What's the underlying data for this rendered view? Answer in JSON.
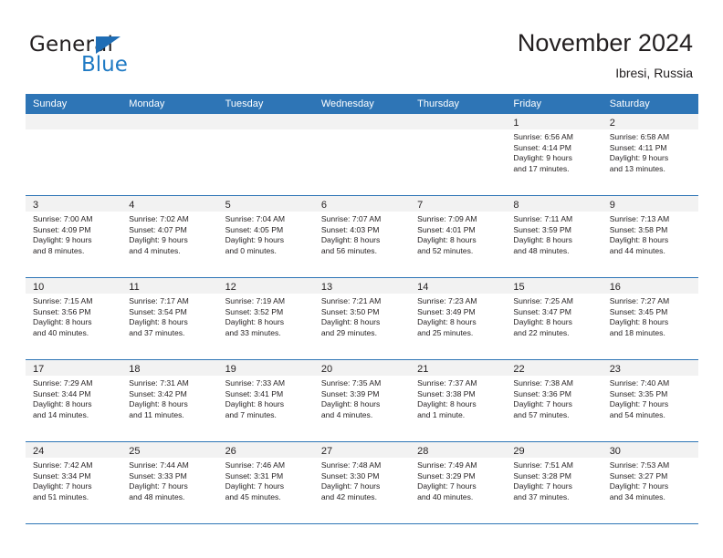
{
  "brand": {
    "name_part1": "General",
    "name_part2": "Blue",
    "triangle_icon": "triangle-icon",
    "accent_color": "#1f7ac4"
  },
  "header": {
    "title": "November 2024",
    "subtitle": "Ibresi, Russia"
  },
  "calendar": {
    "header_bg": "#2e75b6",
    "daynum_strip_bg": "#f2f2f2",
    "weekdays": [
      "Sunday",
      "Monday",
      "Tuesday",
      "Wednesday",
      "Thursday",
      "Friday",
      "Saturday"
    ],
    "weeks": [
      [
        {
          "day": "",
          "empty": true
        },
        {
          "day": "",
          "empty": true
        },
        {
          "day": "",
          "empty": true
        },
        {
          "day": "",
          "empty": true
        },
        {
          "day": "",
          "empty": true
        },
        {
          "day": "1",
          "sunrise": "Sunrise: 6:56 AM",
          "sunset": "Sunset: 4:14 PM",
          "daylight1": "Daylight: 9 hours",
          "daylight2": "and 17 minutes."
        },
        {
          "day": "2",
          "sunrise": "Sunrise: 6:58 AM",
          "sunset": "Sunset: 4:11 PM",
          "daylight1": "Daylight: 9 hours",
          "daylight2": "and 13 minutes."
        }
      ],
      [
        {
          "day": "3",
          "sunrise": "Sunrise: 7:00 AM",
          "sunset": "Sunset: 4:09 PM",
          "daylight1": "Daylight: 9 hours",
          "daylight2": "and 8 minutes."
        },
        {
          "day": "4",
          "sunrise": "Sunrise: 7:02 AM",
          "sunset": "Sunset: 4:07 PM",
          "daylight1": "Daylight: 9 hours",
          "daylight2": "and 4 minutes."
        },
        {
          "day": "5",
          "sunrise": "Sunrise: 7:04 AM",
          "sunset": "Sunset: 4:05 PM",
          "daylight1": "Daylight: 9 hours",
          "daylight2": "and 0 minutes."
        },
        {
          "day": "6",
          "sunrise": "Sunrise: 7:07 AM",
          "sunset": "Sunset: 4:03 PM",
          "daylight1": "Daylight: 8 hours",
          "daylight2": "and 56 minutes."
        },
        {
          "day": "7",
          "sunrise": "Sunrise: 7:09 AM",
          "sunset": "Sunset: 4:01 PM",
          "daylight1": "Daylight: 8 hours",
          "daylight2": "and 52 minutes."
        },
        {
          "day": "8",
          "sunrise": "Sunrise: 7:11 AM",
          "sunset": "Sunset: 3:59 PM",
          "daylight1": "Daylight: 8 hours",
          "daylight2": "and 48 minutes."
        },
        {
          "day": "9",
          "sunrise": "Sunrise: 7:13 AM",
          "sunset": "Sunset: 3:58 PM",
          "daylight1": "Daylight: 8 hours",
          "daylight2": "and 44 minutes."
        }
      ],
      [
        {
          "day": "10",
          "sunrise": "Sunrise: 7:15 AM",
          "sunset": "Sunset: 3:56 PM",
          "daylight1": "Daylight: 8 hours",
          "daylight2": "and 40 minutes."
        },
        {
          "day": "11",
          "sunrise": "Sunrise: 7:17 AM",
          "sunset": "Sunset: 3:54 PM",
          "daylight1": "Daylight: 8 hours",
          "daylight2": "and 37 minutes."
        },
        {
          "day": "12",
          "sunrise": "Sunrise: 7:19 AM",
          "sunset": "Sunset: 3:52 PM",
          "daylight1": "Daylight: 8 hours",
          "daylight2": "and 33 minutes."
        },
        {
          "day": "13",
          "sunrise": "Sunrise: 7:21 AM",
          "sunset": "Sunset: 3:50 PM",
          "daylight1": "Daylight: 8 hours",
          "daylight2": "and 29 minutes."
        },
        {
          "day": "14",
          "sunrise": "Sunrise: 7:23 AM",
          "sunset": "Sunset: 3:49 PM",
          "daylight1": "Daylight: 8 hours",
          "daylight2": "and 25 minutes."
        },
        {
          "day": "15",
          "sunrise": "Sunrise: 7:25 AM",
          "sunset": "Sunset: 3:47 PM",
          "daylight1": "Daylight: 8 hours",
          "daylight2": "and 22 minutes."
        },
        {
          "day": "16",
          "sunrise": "Sunrise: 7:27 AM",
          "sunset": "Sunset: 3:45 PM",
          "daylight1": "Daylight: 8 hours",
          "daylight2": "and 18 minutes."
        }
      ],
      [
        {
          "day": "17",
          "sunrise": "Sunrise: 7:29 AM",
          "sunset": "Sunset: 3:44 PM",
          "daylight1": "Daylight: 8 hours",
          "daylight2": "and 14 minutes."
        },
        {
          "day": "18",
          "sunrise": "Sunrise: 7:31 AM",
          "sunset": "Sunset: 3:42 PM",
          "daylight1": "Daylight: 8 hours",
          "daylight2": "and 11 minutes."
        },
        {
          "day": "19",
          "sunrise": "Sunrise: 7:33 AM",
          "sunset": "Sunset: 3:41 PM",
          "daylight1": "Daylight: 8 hours",
          "daylight2": "and 7 minutes."
        },
        {
          "day": "20",
          "sunrise": "Sunrise: 7:35 AM",
          "sunset": "Sunset: 3:39 PM",
          "daylight1": "Daylight: 8 hours",
          "daylight2": "and 4 minutes."
        },
        {
          "day": "21",
          "sunrise": "Sunrise: 7:37 AM",
          "sunset": "Sunset: 3:38 PM",
          "daylight1": "Daylight: 8 hours",
          "daylight2": "and 1 minute."
        },
        {
          "day": "22",
          "sunrise": "Sunrise: 7:38 AM",
          "sunset": "Sunset: 3:36 PM",
          "daylight1": "Daylight: 7 hours",
          "daylight2": "and 57 minutes."
        },
        {
          "day": "23",
          "sunrise": "Sunrise: 7:40 AM",
          "sunset": "Sunset: 3:35 PM",
          "daylight1": "Daylight: 7 hours",
          "daylight2": "and 54 minutes."
        }
      ],
      [
        {
          "day": "24",
          "sunrise": "Sunrise: 7:42 AM",
          "sunset": "Sunset: 3:34 PM",
          "daylight1": "Daylight: 7 hours",
          "daylight2": "and 51 minutes."
        },
        {
          "day": "25",
          "sunrise": "Sunrise: 7:44 AM",
          "sunset": "Sunset: 3:33 PM",
          "daylight1": "Daylight: 7 hours",
          "daylight2": "and 48 minutes."
        },
        {
          "day": "26",
          "sunrise": "Sunrise: 7:46 AM",
          "sunset": "Sunset: 3:31 PM",
          "daylight1": "Daylight: 7 hours",
          "daylight2": "and 45 minutes."
        },
        {
          "day": "27",
          "sunrise": "Sunrise: 7:48 AM",
          "sunset": "Sunset: 3:30 PM",
          "daylight1": "Daylight: 7 hours",
          "daylight2": "and 42 minutes."
        },
        {
          "day": "28",
          "sunrise": "Sunrise: 7:49 AM",
          "sunset": "Sunset: 3:29 PM",
          "daylight1": "Daylight: 7 hours",
          "daylight2": "and 40 minutes."
        },
        {
          "day": "29",
          "sunrise": "Sunrise: 7:51 AM",
          "sunset": "Sunset: 3:28 PM",
          "daylight1": "Daylight: 7 hours",
          "daylight2": "and 37 minutes."
        },
        {
          "day": "30",
          "sunrise": "Sunrise: 7:53 AM",
          "sunset": "Sunset: 3:27 PM",
          "daylight1": "Daylight: 7 hours",
          "daylight2": "and 34 minutes."
        }
      ]
    ]
  }
}
